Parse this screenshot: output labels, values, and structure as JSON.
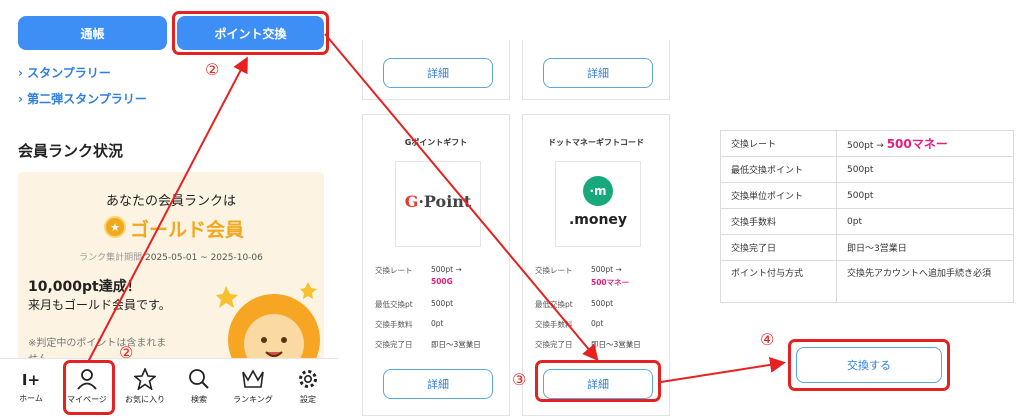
{
  "header": {
    "passbook_label": "通帳",
    "exchange_label": "ポイント交換"
  },
  "links": {
    "stamp_rally": "スタンプラリー",
    "stamp_rally_2": "第二弾スタンプラリー",
    "chevron": "›"
  },
  "rank": {
    "heading": "会員ランク状況",
    "intro": "あなたの会員ランクは",
    "name": "ゴールド会員",
    "period_label": "ランク集計期間",
    "period_value": "2025-05-01 ~ 2025-10-06",
    "achieved": "10,000pt達成！",
    "next_month": "来月もゴールド会員です。",
    "note": "※判定中のポイントは含まれま",
    "note_cont": "せん。"
  },
  "bottom_nav": {
    "home": "ホーム",
    "mypage": "マイページ",
    "favorites": "お気に入り",
    "search": "検索",
    "ranking": "ランキング",
    "settings": "設定"
  },
  "gift_list": {
    "detail_label": "詳細",
    "gpoint": {
      "title": "Gポイントギフト",
      "logo_text": "G·Point",
      "rate_label": "交換レート",
      "rate_value": "500pt →",
      "rate_result": "500G",
      "min_label": "最低交換pt",
      "min_value": "500pt",
      "fee_label": "交換手数料",
      "fee_value": "0pt",
      "time_label": "交換完了日",
      "time_value": "即日〜3営業日"
    },
    "money": {
      "title": "ドットマネーギフトコード",
      "logo_text": ".money",
      "logo_mark": "·m",
      "rate_label": "交換レート",
      "rate_value": "500pt →",
      "rate_result": "500マネー",
      "min_label": "最低交換pt",
      "min_value": "500pt",
      "fee_label": "交換手数料",
      "fee_value": "0pt",
      "time_label": "交換完了日",
      "time_value": "即日〜3営業日"
    }
  },
  "detail_table": {
    "rows": [
      {
        "label": "交換レート",
        "value": "500pt → ",
        "value_hot": "500マネー"
      },
      {
        "label": "最低交換ポイント",
        "value": "500pt"
      },
      {
        "label": "交換単位ポイント",
        "value": "500pt"
      },
      {
        "label": "交換手数料",
        "value": " 0pt"
      },
      {
        "label": "交換完了日",
        "value": "即日〜3営業日"
      },
      {
        "label": "ポイント付与方式",
        "value": "交換先アカウントへ追加手続き必須"
      }
    ],
    "exchange_button": "交換する"
  },
  "annotations": {
    "step2_top": "②",
    "step2_bottom": "②",
    "step3": "③",
    "step4": "④",
    "color": "#e52222"
  },
  "colors": {
    "primary": "#3d8ef5",
    "gold": "#f0a81f",
    "accent_pink": "#e91e7a",
    "link": "#2f7fe0"
  }
}
